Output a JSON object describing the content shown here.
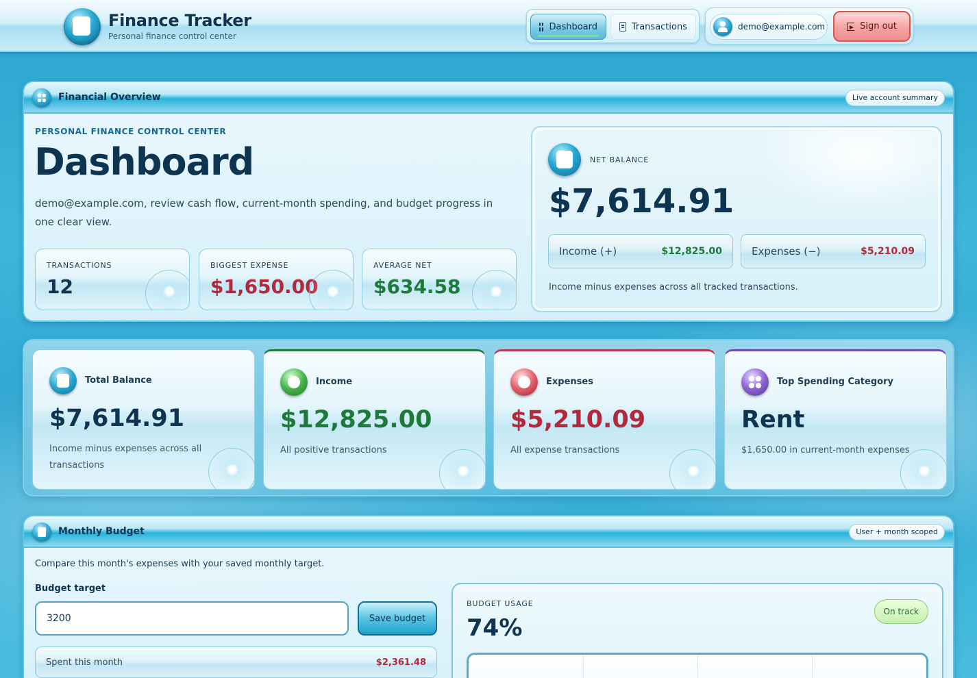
{
  "header": {
    "app_title": "Finance Tracker",
    "app_subtitle": "Personal finance control center",
    "nav": {
      "dashboard": "Dashboard",
      "transactions": "Transactions"
    },
    "user_email": "demo@example.com",
    "signout": "Sign out"
  },
  "overview": {
    "bar_title": "Financial Overview",
    "bar_chip": "Live account summary",
    "eyebrow": "PERSONAL FINANCE CONTROL CENTER",
    "heading": "Dashboard",
    "intro": "demo@example.com, review cash flow, current-month spending, and budget progress in one clear view.",
    "stats": [
      {
        "label": "TRANSACTIONS",
        "value": "12"
      },
      {
        "label": "BIGGEST EXPENSE",
        "value": "$1,650.00"
      },
      {
        "label": "AVERAGE NET",
        "value": "$634.58"
      }
    ],
    "net": {
      "label": "NET BALANCE",
      "value": "$7,614.91",
      "income_label": "Income (+)",
      "income_value": "$12,825.00",
      "expenses_label": "Expenses (−)",
      "expenses_value": "$5,210.09",
      "note": "Income minus expenses across all tracked transactions."
    }
  },
  "metrics": [
    {
      "title": "Total Balance",
      "value": "$7,614.91",
      "desc": "Income minus expenses across all transactions"
    },
    {
      "title": "Income",
      "value": "$12,825.00",
      "desc": "All positive transactions"
    },
    {
      "title": "Expenses",
      "value": "$5,210.09",
      "desc": "All expense transactions"
    },
    {
      "title": "Top Spending Category",
      "value": "Rent",
      "desc": "$1,650.00 in current-month expenses"
    }
  ],
  "budget": {
    "bar_title": "Monthly Budget",
    "bar_chip": "User + month scoped",
    "desc": "Compare this month's expenses with your saved monthly target.",
    "target_label": "Budget target",
    "target_value": "3200",
    "save_label": "Save budget",
    "spent_label": "Spent this month",
    "spent_value": "$2,361.48",
    "usage_label": "BUDGET USAGE",
    "usage_percent": "74%",
    "status": "On track"
  },
  "colors": {
    "positive": "#1e7a3a",
    "negative": "#b3283b",
    "accent": "#27a7d0",
    "category": "#6e4bb3"
  },
  "icons": {
    "brand": "wallet-icon",
    "dashboard": "grid-icon",
    "transactions": "document-icon",
    "user": "user-icon",
    "signout": "exit-icon"
  }
}
